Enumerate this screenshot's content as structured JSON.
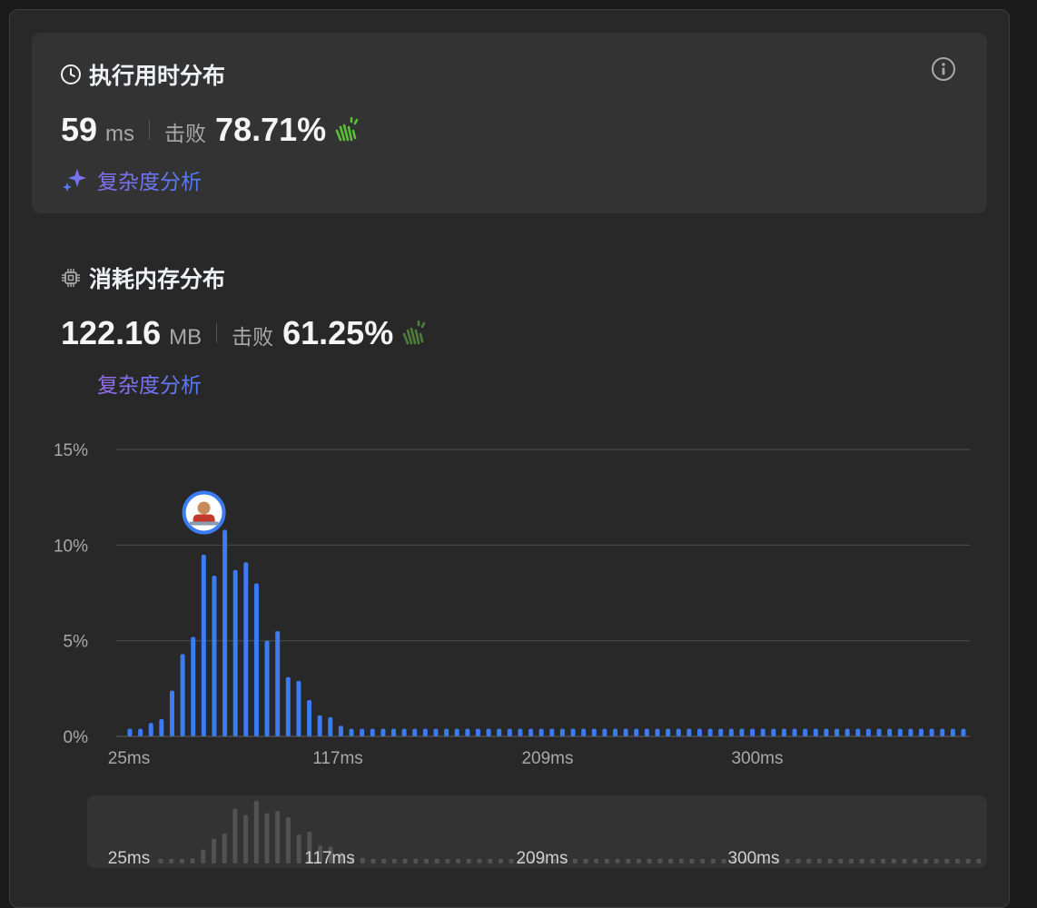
{
  "runtime": {
    "title": "执行用时分布",
    "value": "59",
    "unit": "ms",
    "beat_label": "击败",
    "beat_pct": "78.71%",
    "analysis_label": "复杂度分析"
  },
  "memory": {
    "title": "消耗内存分布",
    "value": "122.16",
    "unit": "MB",
    "beat_label": "击败",
    "beat_pct": "61.25%",
    "analysis_label": "复杂度分析"
  },
  "colors": {
    "bar": "#3b7cf2",
    "mini_bar": "#525252",
    "clap_active": "#5bbf3a",
    "clap_dim": "#4e7d3c"
  },
  "chart_data": {
    "type": "bar",
    "ylim": [
      0,
      15
    ],
    "y_ticks": [
      "15%",
      "10%",
      "5%",
      "0%"
    ],
    "x_tick_labels": [
      "25ms",
      "117ms",
      "209ms",
      "300ms"
    ],
    "values": [
      0.4,
      0.4,
      0.7,
      0.9,
      2.4,
      4.3,
      5.2,
      9.5,
      8.4,
      10.8,
      8.7,
      9.1,
      8.0,
      5.0,
      5.5,
      3.1,
      2.9,
      1.9,
      1.1,
      1.0,
      0.55,
      0.4,
      0.4,
      0.4,
      0.4,
      0.4,
      0.4,
      0.4,
      0.4,
      0.4,
      0.4,
      0.4,
      0.4,
      0.4,
      0.4,
      0.4,
      0.4,
      0.4,
      0.4,
      0.4,
      0.4,
      0.4,
      0.4,
      0.4,
      0.4,
      0.4,
      0.4,
      0.4,
      0.4,
      0.4,
      0.4,
      0.4,
      0.4,
      0.4,
      0.4,
      0.4,
      0.4,
      0.4,
      0.4,
      0.4,
      0.4,
      0.4,
      0.4,
      0.4,
      0.4,
      0.4,
      0.4,
      0.4,
      0.4,
      0.4,
      0.4,
      0.4,
      0.4,
      0.4,
      0.4,
      0.4,
      0.4,
      0.4,
      0.4,
      0.4
    ],
    "highlight_index": 9,
    "grid": true
  }
}
